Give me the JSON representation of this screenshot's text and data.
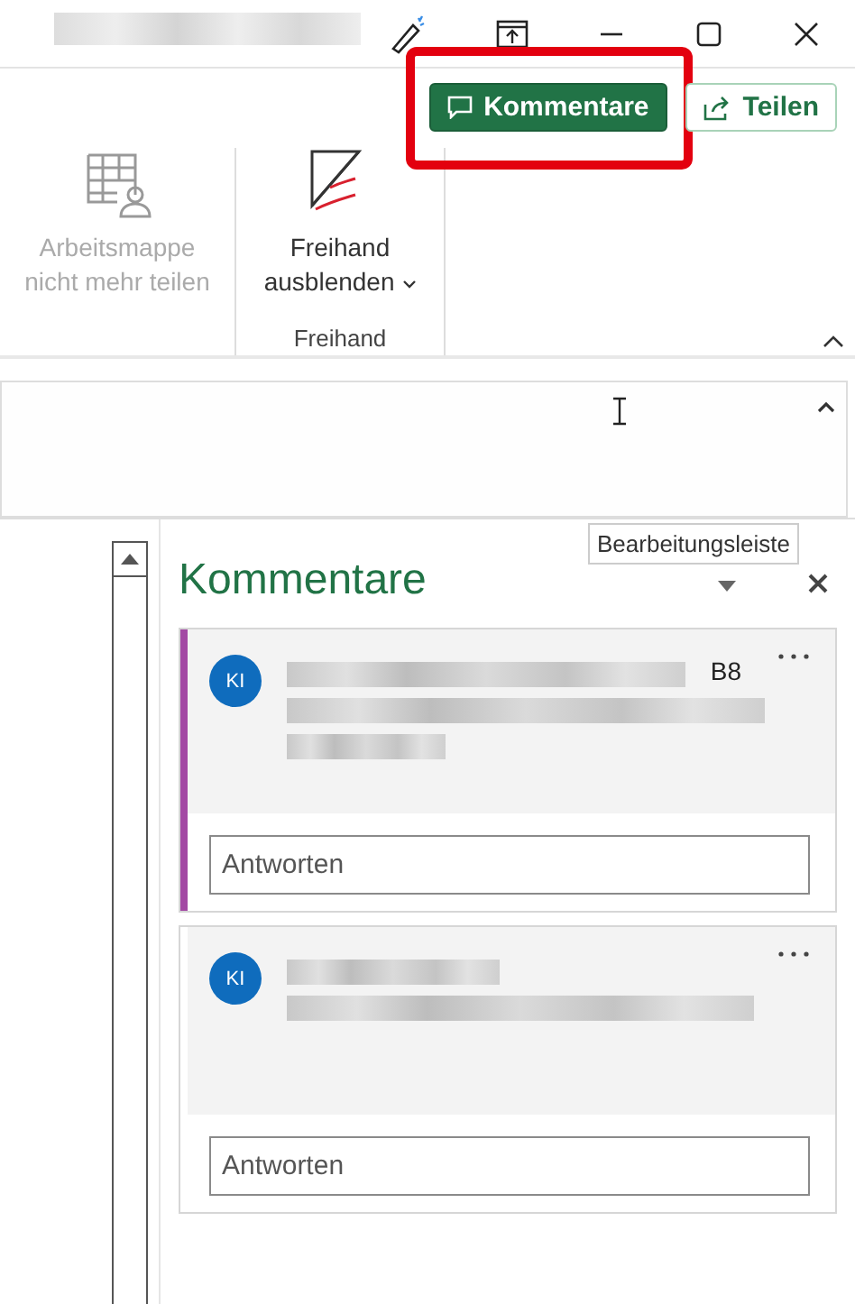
{
  "ribbon": {
    "top_buttons": [
      {
        "label": "Kommentare",
        "kind": "primary",
        "highlighted": true
      },
      {
        "label": "Teilen",
        "kind": "outline",
        "highlighted": false
      }
    ],
    "groups": [
      {
        "commands": [
          {
            "label": "Arbeitsmappe nicht mehr teilen",
            "kind": "unshare",
            "disabled": true,
            "dropdown": false
          }
        ]
      },
      {
        "name": "Freihand",
        "commands": [
          {
            "label": "Freihand ausblenden",
            "kind": "ink",
            "disabled": false,
            "dropdown": true
          }
        ]
      }
    ]
  },
  "formula_bar": {
    "tooltip": "Bearbeitungsleiste"
  },
  "comments_pane": {
    "title": "Kommentare",
    "comments": [
      {
        "initials": "KI",
        "cell": "B8",
        "active": true,
        "reply_placeholder": "Antworten"
      },
      {
        "initials": "KI",
        "active": false,
        "reply_placeholder": "Antworten"
      }
    ]
  }
}
